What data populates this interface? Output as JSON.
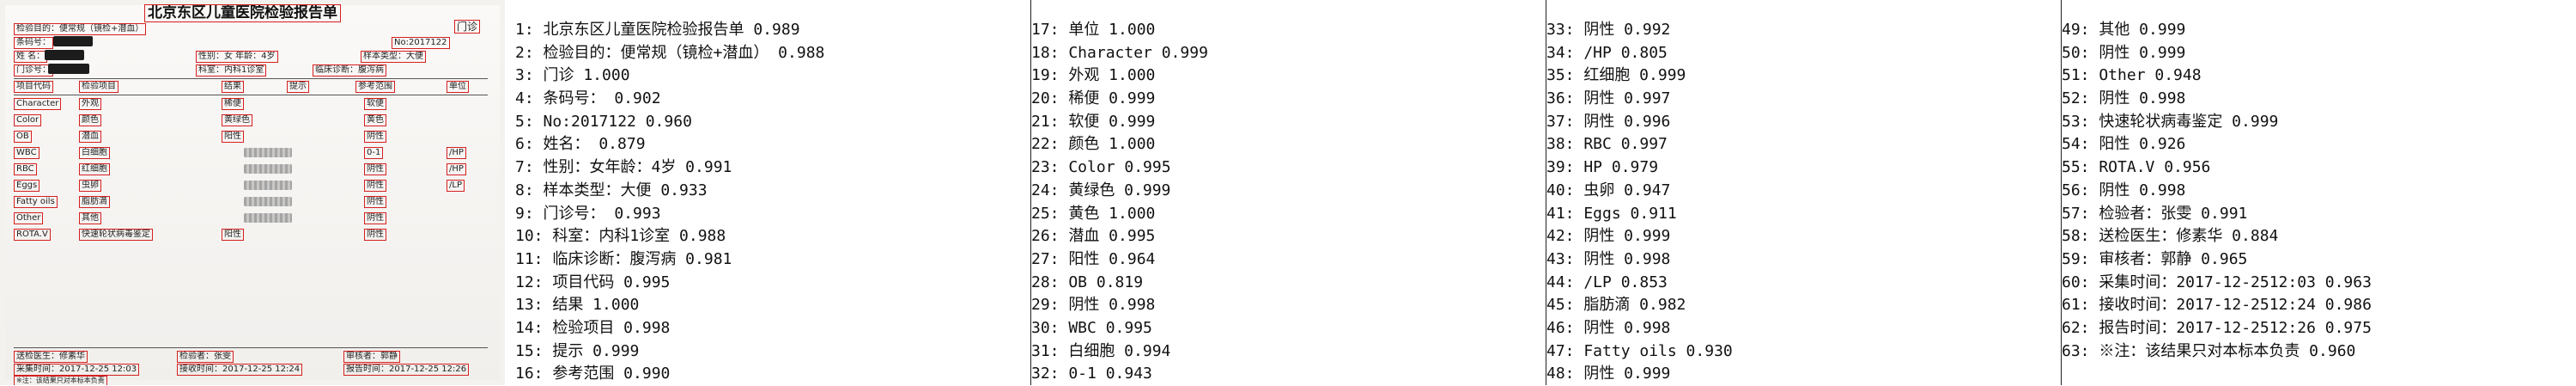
{
  "document": {
    "title": "北京东区儿童医院检验报告单",
    "boxes": {
      "exam_purpose": "检验目的：便常规（镜检+潜血）",
      "outpatient": "门诊",
      "barcode": "条码号：",
      "report_no": "No:2017122",
      "name": "姓 名：",
      "gender_age": "性别：女  年龄：4岁",
      "specimen": "样本类型：大便",
      "clinic_no": "门诊号：",
      "department": "科室：内科1诊室",
      "diagnosis": "临床诊断：腹泻病",
      "col_code": "项目代码",
      "col_item": "检验项目",
      "col_result": "结果",
      "col_hint": "提示",
      "col_range": "参考范围",
      "col_unit": "单位",
      "inspector": "检验者：张雯",
      "auditor": "审核者：郭静",
      "sender": "送检医生：修素华",
      "collect_time": "采集时间：2017-12-25 12:03",
      "receive_time": "接收时间：2017-12-25 12:24",
      "report_time": "报告时间：2017-12-25 12:26",
      "note": "※注：该结果只对本标本负责"
    },
    "rows": [
      {
        "code": "Character",
        "item": "外观",
        "result": "稀便",
        "range": "软便"
      },
      {
        "code": "Color",
        "item": "颜色",
        "result": "黄绿色",
        "range": "黄色"
      },
      {
        "code": "OB",
        "item": "潜血",
        "result": "阳性",
        "range": "阴性"
      },
      {
        "code": "WBC",
        "item": "白细胞",
        "result": "",
        "range": "0-1",
        "unit": "/HP"
      },
      {
        "code": "RBC",
        "item": "红细胞",
        "result": "",
        "range": "阴性",
        "unit": "/HP"
      },
      {
        "code": "Eggs",
        "item": "虫卵",
        "result": "",
        "range": "阴性",
        "unit": "/LP"
      },
      {
        "code": "Fatty oils",
        "item": "脂肪滴",
        "result": "",
        "range": "阴性"
      },
      {
        "code": "Other",
        "item": "其他",
        "result": "",
        "range": "阴性"
      },
      {
        "code": "ROTA.V",
        "item": "快速轮状病毒鉴定",
        "result": "阳性",
        "range": "阴性"
      }
    ]
  },
  "ocr_lines": [
    "1: 北京东区儿童医院检验报告单   0.989",
    "2: 检验目的：便常规（镜检+潜血）   0.988",
    "3: 门诊   1.000",
    "4: 条码号：   0.902",
    "5: No:2017122   0.960",
    "6: 姓名：   0.879",
    "7: 性别：女年龄：4岁   0.991",
    "8: 样本类型：大便   0.933",
    "9: 门诊号：   0.993",
    "10: 科室：内科1诊室   0.988",
    "11: 临床诊断：腹泻病   0.981",
    "12: 项目代码   0.995",
    "13: 结果   1.000",
    "14: 检验项目   0.998",
    "15: 提示   0.999",
    "16: 参考范围   0.990",
    "17: 单位   1.000",
    "18: Character   0.999",
    "19: 外观   1.000",
    "20: 稀便   0.999",
    "21: 软便   0.999",
    "22: 颜色   1.000",
    "23: Color   0.995",
    "24: 黄绿色   0.999",
    "25: 黄色   1.000",
    "26: 潜血   0.995",
    "27: 阳性   0.964",
    "28: OB   0.819",
    "29: 阴性   0.998",
    "30: WBC   0.995",
    "31: 白细胞   0.994",
    "32: 0-1   0.943",
    "33: 阴性   0.992",
    "34: /HP   0.805",
    "35: 红细胞   0.999",
    "36: 阴性   0.997",
    "37: 阴性   0.996",
    "38: RBC   0.997",
    "39: HP   0.979",
    "40: 虫卵   0.947",
    "41: Eggs   0.911",
    "42: 阴性   0.999",
    "43: 阴性   0.998",
    "44: /LP   0.853",
    "45: 脂肪滴   0.982",
    "46: 阴性   0.998",
    "47: Fatty oils   0.930",
    "48: 阴性   0.999",
    "49: 其他   0.999",
    "50: 阴性   0.999",
    "51: Other   0.948",
    "52: 阴性   0.998",
    "53: 快速轮状病毒鉴定   0.999",
    "54: 阳性   0.926",
    "55: ROTA.V   0.956",
    "56: 阴性   0.998",
    "57: 检验者：张雯   0.991",
    "58: 送检医生：修素华   0.884",
    "59: 审核者：郭静   0.965",
    "60: 采集时间：2017-12-2512:03   0.963",
    "61: 接收时间：2017-12-2512:24   0.986",
    "62: 报告时间：2017-12-2512:26   0.975",
    "63: ※注：该结果只对本标本负责   0.960"
  ]
}
